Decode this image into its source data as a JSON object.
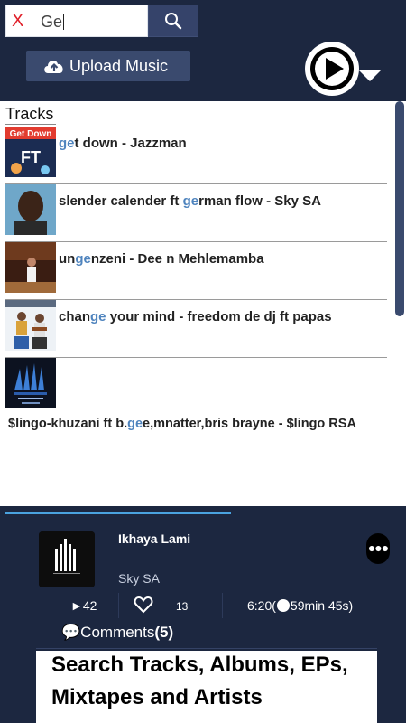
{
  "search": {
    "clear_label": "X",
    "query": "Ge"
  },
  "upload": {
    "label": "Upload Music"
  },
  "tracks_section": {
    "title": "Tracks"
  },
  "tracks": [
    {
      "pre": "",
      "hl": "ge",
      "post": "t down - Jazzman",
      "thumb_text": "Get Down"
    },
    {
      "pre": "slender calender ft ",
      "hl": "ge",
      "post": "rman flow - Sky SA"
    },
    {
      "pre": "un",
      "hl": "ge",
      "post": "nzeni - Dee n Mehlemamba"
    },
    {
      "pre": "chan",
      "hl": "ge",
      "post": " your mind - freedom de dj ft papas"
    },
    {
      "pre": "$lingo-khuzani ft b.",
      "hl": "ge",
      "post": "e,mnatter,bris brayne - $lingo RSA"
    }
  ],
  "now_playing": {
    "title": "Ikhaya Lami",
    "artist": "Sky SA",
    "plays": "42",
    "likes": "13",
    "duration": "6:20",
    "duration_long": "59min 45s",
    "comments_label": "Comments",
    "comments_count": "(5)",
    "progress_fraction": 0.56
  },
  "caption": "Search Tracks, Albums, EPs, Mixtapes and Artists",
  "colors": {
    "background": "#1c2740",
    "highlight": "#4f84be",
    "accent": "#4aa3e0"
  }
}
